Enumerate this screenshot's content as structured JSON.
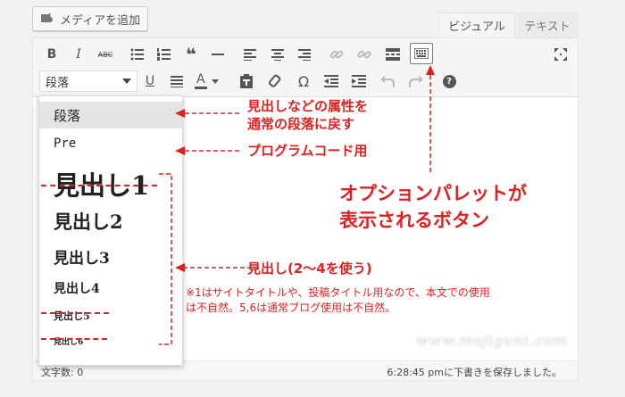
{
  "header": {
    "add_media_label": "メディアを追加",
    "tabs": [
      {
        "label": "ビジュアル",
        "active": true
      },
      {
        "label": "テキスト",
        "active": false
      }
    ]
  },
  "toolbar": {
    "format_select_value": "段落",
    "row1_icons": [
      "bold-icon",
      "italic-icon",
      "strikethrough-icon",
      "bullet-list-icon",
      "numbered-list-icon",
      "blockquote-icon",
      "horizontal-rule-icon",
      "align-left-icon",
      "align-center-icon",
      "align-right-icon",
      "link-icon",
      "unlink-icon",
      "read-more-icon",
      "toolbar-toggle-icon",
      "fullscreen-icon"
    ],
    "row2_icons": [
      "underline-icon",
      "justify-icon",
      "text-color-icon",
      "paste-text-icon",
      "clear-formatting-icon",
      "special-character-icon",
      "outdent-icon",
      "indent-icon",
      "undo-icon",
      "redo-icon",
      "help-icon"
    ],
    "bold_glyph": "B",
    "italic_glyph": "I",
    "strike_glyph": "ABC",
    "quote_glyph": "❝",
    "underline_glyph": "U",
    "text_color_glyph": "A",
    "omega_glyph": "Ω",
    "help_glyph": "?"
  },
  "format_menu": {
    "items": [
      {
        "label": "段落",
        "selected": true,
        "struck": false
      },
      {
        "label": "Pre",
        "selected": false,
        "struck": false
      },
      {
        "label": "見出し1",
        "selected": false,
        "struck": true
      },
      {
        "label": "見出し2",
        "selected": false,
        "struck": false
      },
      {
        "label": "見出し3",
        "selected": false,
        "struck": false
      },
      {
        "label": "見出し4",
        "selected": false,
        "struck": false
      },
      {
        "label": "見出し5",
        "selected": false,
        "struck": true
      },
      {
        "label": "見出し6",
        "selected": false,
        "struck": true
      }
    ]
  },
  "status": {
    "word_count": "文字数: 0",
    "draft_saved": "6:28:45 pmに下書きを保存しました。"
  },
  "annotations": {
    "paragraph_note_line1": "見出しなどの属性を",
    "paragraph_note_line2": "通常の段落に戻す",
    "pre_note": "プログラムコード用",
    "heading_note": "見出し(2〜4を使う)",
    "heading_detail_line1": "※1はサイトタイトルや、投稿タイトル用なので、本文での使用",
    "heading_detail_line2": "は不自然。5,6は通常ブログ使用は不自然。",
    "palette_note_line1": "オプションパレットが",
    "palette_note_line2": "表示されるボタン"
  },
  "watermark": "www.mojiguni.com",
  "colors": {
    "annotation_red": "#e02020",
    "toolbar_bg": "#f5f5f5",
    "selected_item_bg": "#e4e4e4"
  }
}
